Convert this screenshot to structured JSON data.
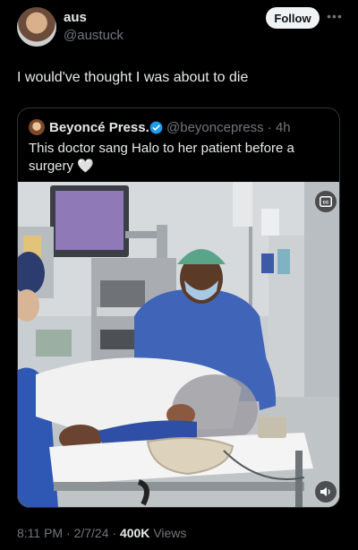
{
  "author": {
    "display_name": "aus",
    "handle": "@austuck",
    "avatar_icon": "profile-photo"
  },
  "follow_label": "Follow",
  "more_icon": "ellipsis-icon",
  "tweet_text": "I would've thought I was about to die",
  "quoted": {
    "display_name": "Beyoncé Press.",
    "verified": true,
    "handle_time": "@beyoncepress · 4h",
    "text_line1": "This doctor sang Halo to her patient before a",
    "text_line2": "surgery",
    "emoji": "🤍"
  },
  "media": {
    "type": "video",
    "top_right_icon": "captions-icon",
    "bottom_right_icon": "volume-icon"
  },
  "meta": {
    "time": "8:11 PM",
    "date": "2/7/24",
    "views": "400K",
    "views_label": "Views"
  },
  "colors": {
    "background": "#000000",
    "text": "#e7e9ea",
    "secondary_text": "#71767b",
    "verified_blue": "#1d9bf0"
  }
}
